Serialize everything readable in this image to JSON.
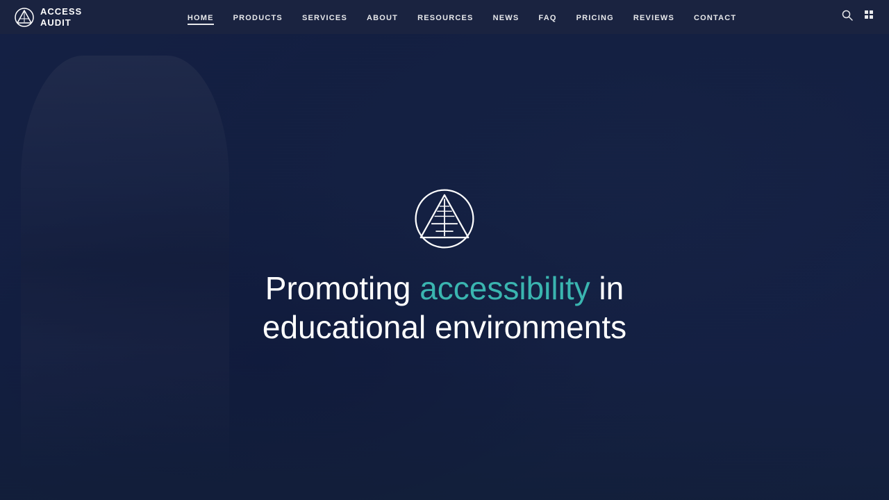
{
  "brand": {
    "name_line1": "ACCESS",
    "name_line2": "AUDIT"
  },
  "nav": {
    "links": [
      {
        "id": "home",
        "label": "HOME",
        "active": true
      },
      {
        "id": "products",
        "label": "PRODUCTS",
        "active": false
      },
      {
        "id": "services",
        "label": "SERVICES",
        "active": false
      },
      {
        "id": "about",
        "label": "ABOUT",
        "active": false
      },
      {
        "id": "resources",
        "label": "RESOURCES",
        "active": false
      },
      {
        "id": "news",
        "label": "NEWS",
        "active": false
      },
      {
        "id": "faq",
        "label": "FAQ",
        "active": false
      },
      {
        "id": "pricing",
        "label": "PRICING",
        "active": false
      },
      {
        "id": "reviews",
        "label": "REVIEWS",
        "active": false
      },
      {
        "id": "contact",
        "label": "CONTACT",
        "active": false
      }
    ]
  },
  "hero": {
    "title_part1": "Promoting ",
    "title_highlight": "accessibility",
    "title_part2": " in",
    "title_line2": "educational environments"
  },
  "colors": {
    "nav_bg": "#1a2340",
    "hero_bg": "#2a3a5c",
    "hero_overlay": "rgba(15,25,60,0.62)",
    "highlight": "#3ab5b0",
    "text_white": "#ffffff"
  }
}
